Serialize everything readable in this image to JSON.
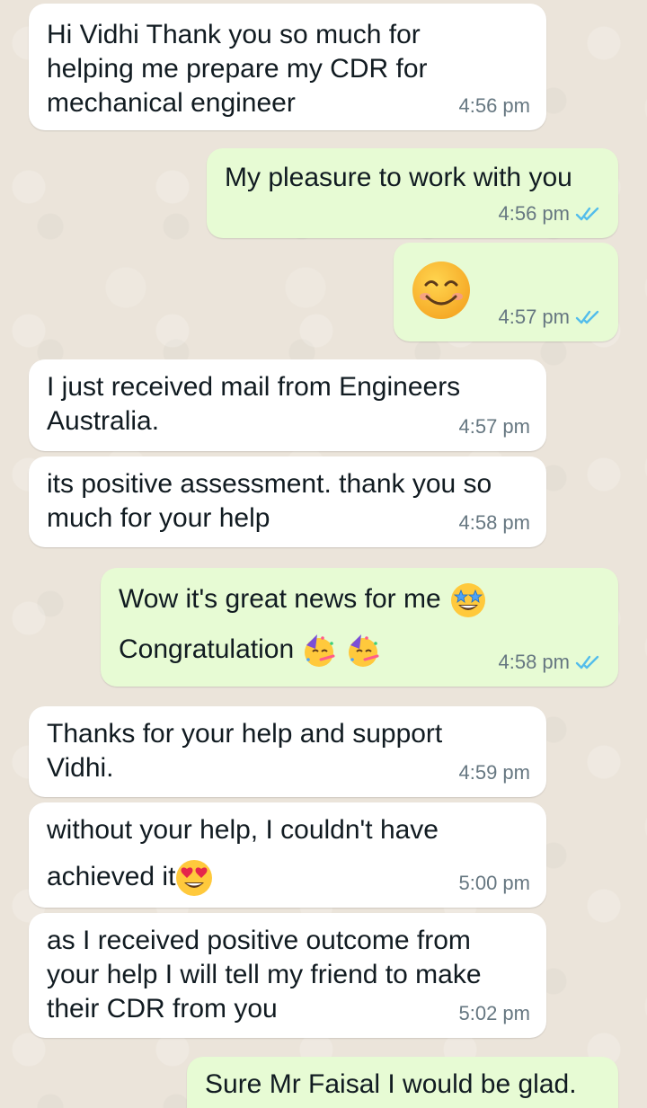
{
  "messages": [
    {
      "id": "m1",
      "direction": "in",
      "text": "Hi Vidhi Thank you so much for\nhelping me prepare my CDR for\nmechanical engineer",
      "time": "4:56 pm"
    },
    {
      "id": "m2",
      "direction": "out",
      "text": "My pleasure to work with you",
      "time": "4:56 pm",
      "status": "read"
    },
    {
      "id": "m3",
      "direction": "out",
      "text": "",
      "emoji": "smiling-face-icon",
      "time": "4:57 pm",
      "status": "read"
    },
    {
      "id": "m4",
      "direction": "in",
      "text": "I just received mail from Engineers\nAustralia.",
      "time": "4:57 pm"
    },
    {
      "id": "m5",
      "direction": "in",
      "text": "its positive assessment. thank you so\nmuch for your help",
      "time": "4:58 pm"
    },
    {
      "id": "m6",
      "direction": "out",
      "text_line1": "Wow it's great news for me",
      "text_line2": "Congratulation",
      "emojis": [
        "star-struck-icon",
        "partying-face-icon",
        "partying-face-icon"
      ],
      "time": "4:58 pm",
      "status": "read"
    },
    {
      "id": "m7",
      "direction": "in",
      "text": "Thanks for your help and support\nVidhi.",
      "time": "4:59 pm"
    },
    {
      "id": "m8",
      "direction": "in",
      "text_line1": "without your help, I couldn't have",
      "text_line2": "achieved it",
      "emoji": "heart-eyes-icon",
      "time": "5:00 pm"
    },
    {
      "id": "m9",
      "direction": "in",
      "text": "as I received positive outcome from\nyour help I will tell my friend to make\ntheir CDR from you",
      "time": "5:02 pm"
    },
    {
      "id": "m10",
      "direction": "out",
      "text": "Sure Mr Faisal I would be glad.",
      "time": ""
    }
  ],
  "colors": {
    "incoming_bubble": "#ffffff",
    "outgoing_bubble": "#e7fbd4",
    "read_ticks": "#53bdeb",
    "timestamp": "#667781",
    "wallpaper": "#ebe4da"
  }
}
